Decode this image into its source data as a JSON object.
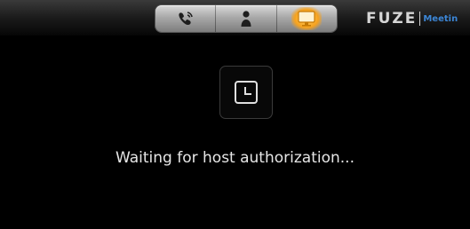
{
  "toolbar": {
    "tabs": [
      {
        "icon": "phone-icon",
        "active": false
      },
      {
        "icon": "person-icon",
        "active": false
      },
      {
        "icon": "monitor-icon",
        "active": true
      }
    ],
    "active_color": "#f6a21e"
  },
  "brand": {
    "logo": "FUZE",
    "subtitle": "Meetin",
    "subtitle_color": "#3c86d6"
  },
  "main": {
    "status_icon": "clock-icon",
    "status_text": "Waiting for host authorization..."
  }
}
